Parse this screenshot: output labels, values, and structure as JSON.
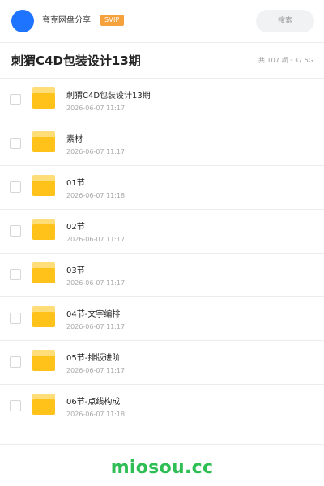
{
  "header": {
    "share_name": "夸克网盘分享",
    "badge": "SVIP",
    "search_label": "搜索"
  },
  "title_bar": {
    "title": "刺猬C4D包装设计13期",
    "summary": "共 107 项 · 37.5G"
  },
  "files": [
    {
      "name": "刺猬C4D包装设计13期",
      "date": "2026-06-07 11:17"
    },
    {
      "name": "素材",
      "date": "2026-06-07 11:17"
    },
    {
      "name": "01节",
      "date": "2026-06-07 11:18"
    },
    {
      "name": "02节",
      "date": "2026-06-07 11:17"
    },
    {
      "name": "03节",
      "date": "2026-06-07 11:17"
    },
    {
      "name": "04节-文字编排",
      "date": "2026-06-07 11:17"
    },
    {
      "name": "05节-排版进阶",
      "date": "2026-06-07 11:17"
    },
    {
      "name": "06节-点线构成",
      "date": "2026-06-07 11:18"
    }
  ],
  "footer": {
    "watermark": "miosou.cc"
  },
  "colors": {
    "avatar": "#1e74ff",
    "svip_badge": "#f6a23c",
    "folder": "#ffc21a",
    "watermark": "#2ebe53"
  },
  "icons": {
    "folder": "folder-icon",
    "avatar": "avatar"
  }
}
